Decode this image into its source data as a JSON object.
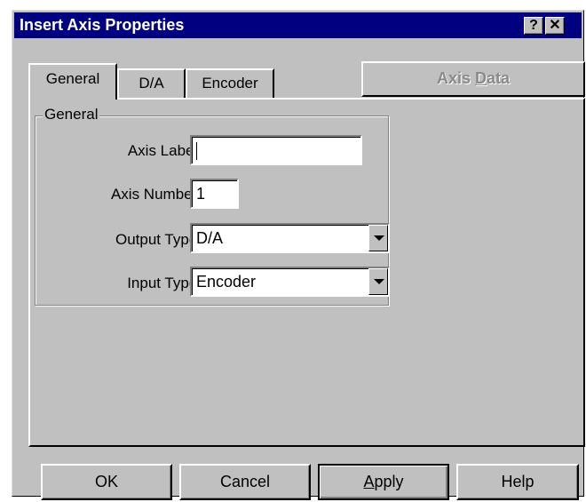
{
  "window": {
    "title": "Insert Axis Properties",
    "help_glyph": "?",
    "close_glyph": "✕"
  },
  "tabs": [
    {
      "label": "General",
      "active": true
    },
    {
      "label": "D/A",
      "active": false
    },
    {
      "label": "Encoder",
      "active": false
    }
  ],
  "axis_data_button": {
    "label_pre": "Axis ",
    "label_mnemonic": "D",
    "label_post": "ata",
    "enabled": false
  },
  "general_group": {
    "title": "General",
    "axis_label": {
      "label": "Axis Label:",
      "value": ""
    },
    "axis_number": {
      "label": "Axis Number:",
      "value": "1"
    },
    "output_type": {
      "label": "Output Type:",
      "value": "D/A"
    },
    "input_type": {
      "label": "Input Type:",
      "value": "Encoder"
    }
  },
  "buttons": {
    "ok": "OK",
    "cancel": "Cancel",
    "apply_mnemonic": "A",
    "apply_rest": "pply",
    "help": "Help"
  },
  "colors": {
    "titlebar": "#000080",
    "face": "#c0c0c0",
    "disabled_text": "#8a8a8a"
  }
}
